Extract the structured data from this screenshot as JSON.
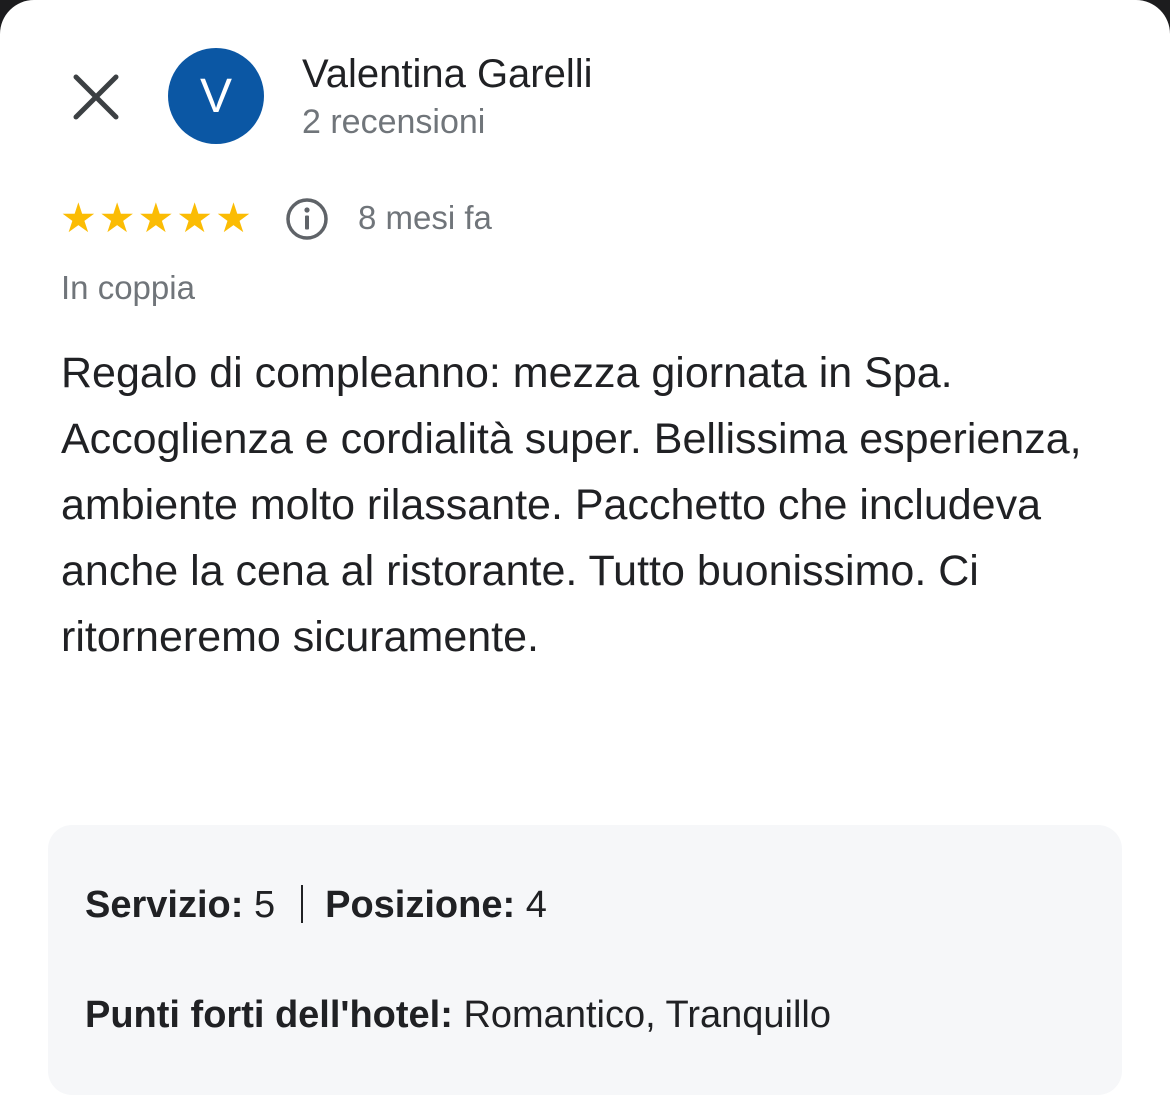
{
  "header": {
    "close_icon": "close-icon",
    "avatar_letter": "V",
    "avatar_color": "#0b57a4",
    "reviewer_name": "Valentina Garelli",
    "review_count": "2 recensioni"
  },
  "review": {
    "rating": 5,
    "rating_max": 5,
    "star_color": "#fbbc04",
    "info_icon": "info-icon",
    "time_ago": "8 mesi fa",
    "trip_type": "In coppia",
    "text": "Regalo di compleanno: mezza giornata in Spa. Accoglienza e cordialità super. Bellissima esperienza, ambiente molto rilassante. Pacchetto che includeva anche la cena al ristorante. Tutto buonissimo. Ci ritorneremo sicuramente."
  },
  "ratings": {
    "service_label": "Servizio:",
    "service_value": "5",
    "location_label": "Posizione:",
    "location_value": "4",
    "highlights_label": "Punti forti dell'hotel:",
    "highlights_value": "Romantico, Tranquillo"
  }
}
